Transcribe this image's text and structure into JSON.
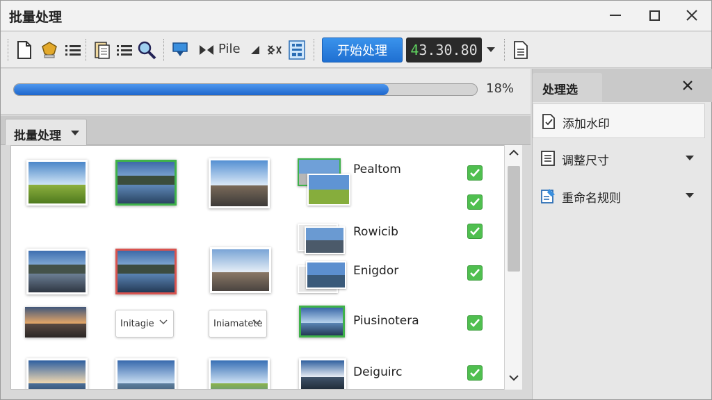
{
  "window": {
    "title": "批量处理"
  },
  "toolbar": {
    "pile_label": "Pile",
    "start_button": "开始处理",
    "counter_green": "4",
    "counter_rest": "3.30.80",
    "icons": [
      "new-file-icon",
      "certificate-icon",
      "list-icon",
      "paste-icon",
      "list-icon",
      "search-icon",
      "download-icon",
      "split-icon",
      "pile",
      "cursor-icon",
      "scissors-icon",
      "barcode-icon",
      "start-button",
      "counter",
      "dropdown-icon",
      "document-icon"
    ]
  },
  "progress": {
    "value": 0.18,
    "label": "18%"
  },
  "left_tab": {
    "label": "批量处理"
  },
  "grid": {
    "selects": [
      {
        "label": "Initagie"
      },
      {
        "label": "Iniamatete"
      }
    ],
    "items": [
      {
        "label": "Pealtom",
        "checked": true
      },
      {
        "label": "",
        "checked": true
      },
      {
        "label": "Rowicib",
        "checked": true
      },
      {
        "label": "Enigdor",
        "checked": true
      },
      {
        "label": "Piusinotera",
        "checked": true
      },
      {
        "label": "Deiguirc",
        "checked": true
      }
    ]
  },
  "right_panel": {
    "title": "处理选",
    "items": [
      {
        "label": "添加水印",
        "icon": "watermark-icon"
      },
      {
        "label": "调整尺寸",
        "icon": "resize-icon"
      },
      {
        "label": "重命名规则",
        "icon": "rename-icon"
      }
    ]
  },
  "colors": {
    "accent": "#1f6fd1",
    "check": "#4fbf4f",
    "selected_green": "#3fb24a",
    "selected_red": "#d9534f"
  }
}
